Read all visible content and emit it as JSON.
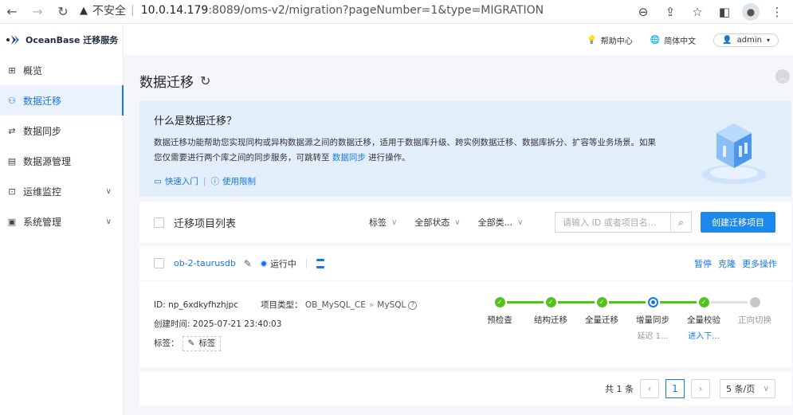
{
  "browser": {
    "security_label": "不安全",
    "url_host": "10.0.14.179",
    "url_rest": ":8089/oms-v2/migration?pageNumber=1&type=MIGRATION"
  },
  "brand": {
    "name": "OceanBase 迁移服务"
  },
  "sidebar": {
    "items": [
      {
        "label": "概览",
        "icon": "grid-icon",
        "active": false,
        "has_children": false
      },
      {
        "label": "数据迁移",
        "icon": "migration-icon",
        "active": true,
        "has_children": false
      },
      {
        "label": "数据同步",
        "icon": "sync-icon",
        "active": false,
        "has_children": false
      },
      {
        "label": "数据源管理",
        "icon": "datasource-icon",
        "active": false,
        "has_children": false
      },
      {
        "label": "运维监控",
        "icon": "monitor-icon",
        "active": false,
        "has_children": true
      },
      {
        "label": "系统管理",
        "icon": "system-icon",
        "active": false,
        "has_children": true
      }
    ]
  },
  "topbar": {
    "help": "帮助中心",
    "language": "简体中文",
    "user": "admin"
  },
  "page": {
    "title": "数据迁移"
  },
  "intro": {
    "title": "什么是数据迁移？",
    "desc_part1": "数据迁移功能帮助您实现同构或异构数据源之间的数据迁移，适用于数据库升级、跨实例数据迁移、数据库拆分、扩容等业务场景。如果您仅需要进行两个库之间的同步服务，可跳转至 ",
    "desc_link": "数据同步",
    "desc_part2": " 进行操作。",
    "quick_start": "快速入门",
    "limits": "使用限制"
  },
  "toolbar": {
    "list_title": "迁移项目列表",
    "filter_tag": "标签",
    "filter_status": "全部状态",
    "filter_type": "全部类...",
    "search_placeholder": "请输入 ID 或者项目名...",
    "create_label": "创建迁移项目"
  },
  "project": {
    "name": "ob-2-taurusdb",
    "status": "运行中",
    "actions": {
      "pause": "暂停",
      "clone": "克隆",
      "more": "更多操作"
    },
    "id_label": "ID:",
    "id_value": "np_6xdkyfhzhjpc",
    "type_label": "项目类型：",
    "type_source": "OB_MySQL_CE",
    "type_arrow": "»",
    "type_target": "MySQL",
    "created_label": "创建时间:",
    "created_value": "2025-07-21 23:40:03",
    "tag_label": "标签：",
    "tag_btn": "标签",
    "steps": [
      {
        "label": "预检查",
        "state": "done",
        "sub": ""
      },
      {
        "label": "结构迁移",
        "state": "done",
        "sub": ""
      },
      {
        "label": "全量迁移",
        "state": "done",
        "sub": ""
      },
      {
        "label": "增量同步",
        "state": "running",
        "sub": "延迟 1..."
      },
      {
        "label": "全量校验",
        "state": "done",
        "sub": "进入下..."
      },
      {
        "label": "正向切换",
        "state": "pending",
        "sub": ""
      }
    ]
  },
  "pager": {
    "total": "共 1 条",
    "current": "1",
    "page_size": "5 条/页"
  },
  "colors": {
    "primary": "#1677e8",
    "success": "#52c41a",
    "intro_bg": "#e3eefb"
  }
}
